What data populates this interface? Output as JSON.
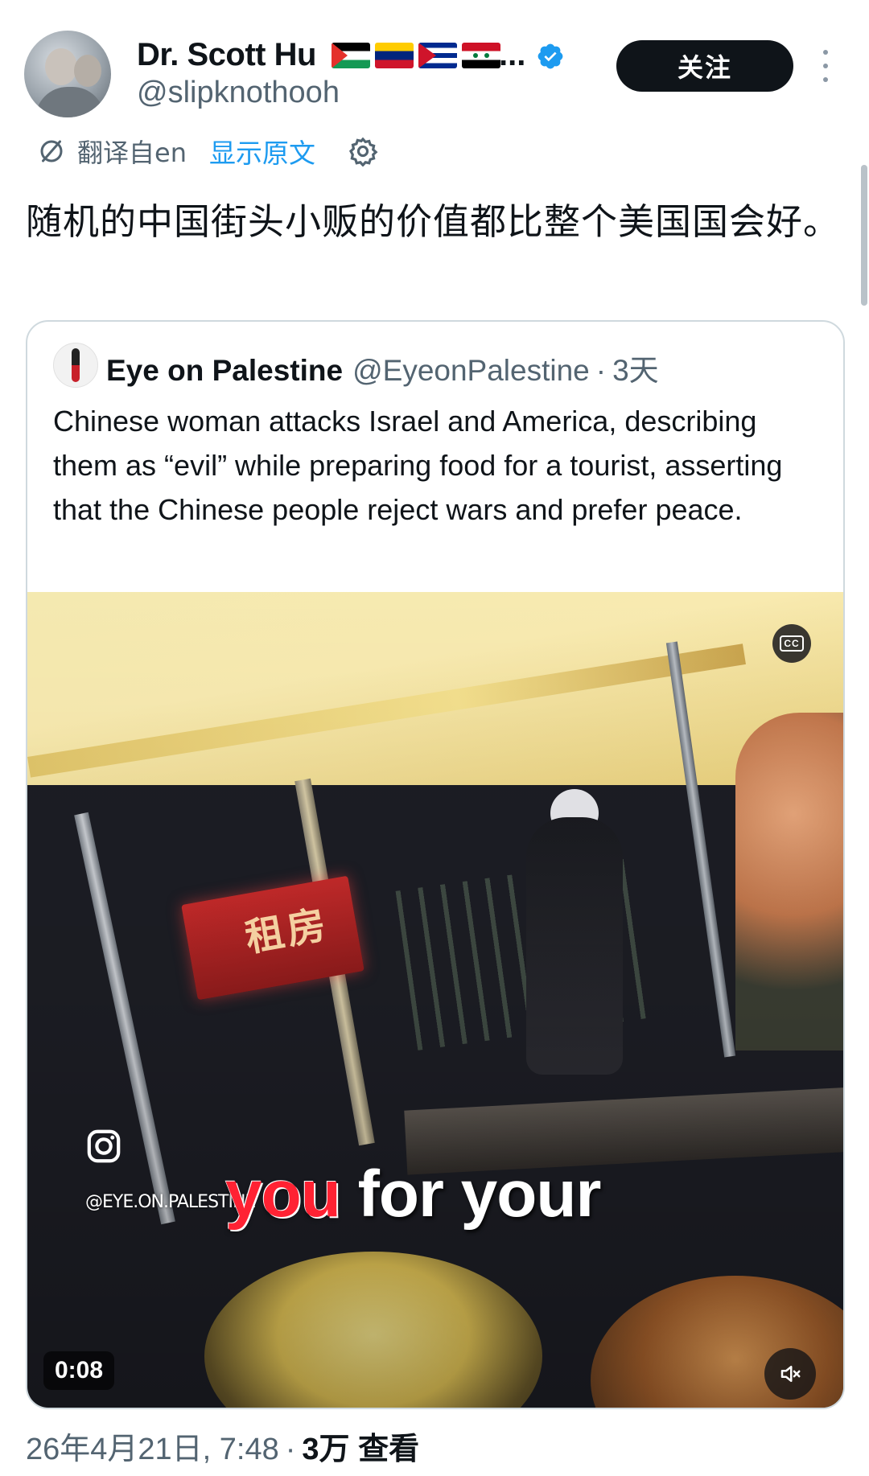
{
  "author": {
    "display_name": "Dr. Scott Hu",
    "name_overflow": "...",
    "handle": "@slipknothooh",
    "flags": [
      "palestine-flag-icon",
      "venezuela-flag-icon",
      "cuba-flag-icon",
      "syria-flag-icon"
    ],
    "verified_icon": "verified-badge-icon"
  },
  "actions": {
    "follow_label": "关注",
    "more_icon": "more-icon"
  },
  "translation": {
    "translated_from": "翻译自en",
    "show_original": "显示原文",
    "translate_icon": "translate-icon",
    "settings_icon": "gear-icon"
  },
  "tweet": {
    "text": "随机的中国街头小贩的价值都比整个美国国会好。"
  },
  "quote": {
    "name": "Eye on Palestine",
    "handle": "@EyeonPalestine",
    "separator": "·",
    "time": "3天",
    "text": "Chinese woman attacks Israel and America, describing them as “evil” while preparing food for a tourist, asserting that the Chinese people reject wars and prefer peace."
  },
  "video": {
    "cc_label": "CC",
    "watermark": "@EYE.ON.PALESTINE",
    "subtitle_highlight": "you",
    "subtitle_rest": "for your",
    "sign_text": "租房",
    "duration": "0:08",
    "mute_icon": "mute-icon",
    "instagram_icon": "instagram-icon"
  },
  "footer": {
    "date": "26年4月21日, 7:48",
    "separator": "·",
    "views": "3万 查看"
  },
  "colors": {
    "accent": "#1d9bf0",
    "text_primary": "#0f1419",
    "text_secondary": "#536471",
    "follow_bg": "#0f1419",
    "subtitle_red": "#ff2233"
  }
}
